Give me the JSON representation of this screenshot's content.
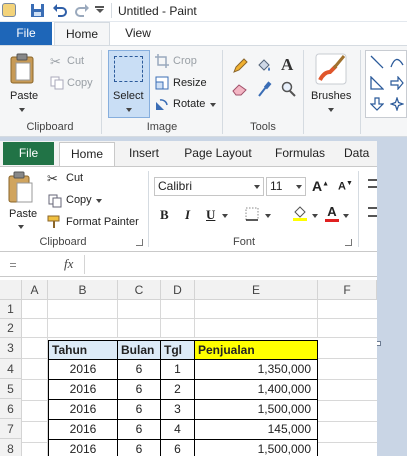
{
  "paint": {
    "title": "Untitled - Paint",
    "tabs": [
      {
        "label": "File"
      },
      {
        "label": "Home"
      },
      {
        "label": "View"
      }
    ],
    "clipboard": {
      "paste": "Paste",
      "cut": "Cut",
      "copy": "Copy",
      "group": "Clipboard"
    },
    "image": {
      "select": "Select",
      "crop": "Crop",
      "resize": "Resize",
      "rotate": "Rotate",
      "group": "Image"
    },
    "tools": {
      "group": "Tools"
    },
    "brushes": {
      "label": "Brushes"
    }
  },
  "excel": {
    "tabs": [
      {
        "label": "File"
      },
      {
        "label": "Home"
      },
      {
        "label": "Insert"
      },
      {
        "label": "Page Layout"
      },
      {
        "label": "Formulas"
      },
      {
        "label": "Data"
      }
    ],
    "clipboard": {
      "paste": "Paste",
      "cut": "Cut",
      "copy": "Copy",
      "format_painter": "Format Painter",
      "group": "Clipboard"
    },
    "font": {
      "name": "Calibri",
      "size": "11",
      "group": "Font",
      "bold": "B",
      "italic": "I",
      "underline": "U",
      "grow": "A",
      "shrink": "A"
    },
    "formula_bar": {
      "fx": "fx",
      "value": ""
    },
    "columns": [
      "A",
      "B",
      "C",
      "D",
      "E",
      "F"
    ],
    "rows": [
      "1",
      "2",
      "3",
      "4",
      "5",
      "6",
      "7",
      "8"
    ],
    "table": {
      "headers": [
        "Tahun",
        "Bulan",
        "Tgl",
        "Penjualan"
      ],
      "rows": [
        [
          "2016",
          "6",
          "1",
          "1,350,000"
        ],
        [
          "2016",
          "6",
          "2",
          "1,400,000"
        ],
        [
          "2016",
          "6",
          "3",
          "1,500,000"
        ],
        [
          "2016",
          "6",
          "4",
          "145,000"
        ],
        [
          "2016",
          "6",
          "6",
          "1,500,000"
        ]
      ]
    }
  },
  "colors": {
    "paint_file": "#1e66b8",
    "excel_file": "#217346",
    "header_blue": "#ddebf7",
    "header_yellow": "#ffff00"
  }
}
